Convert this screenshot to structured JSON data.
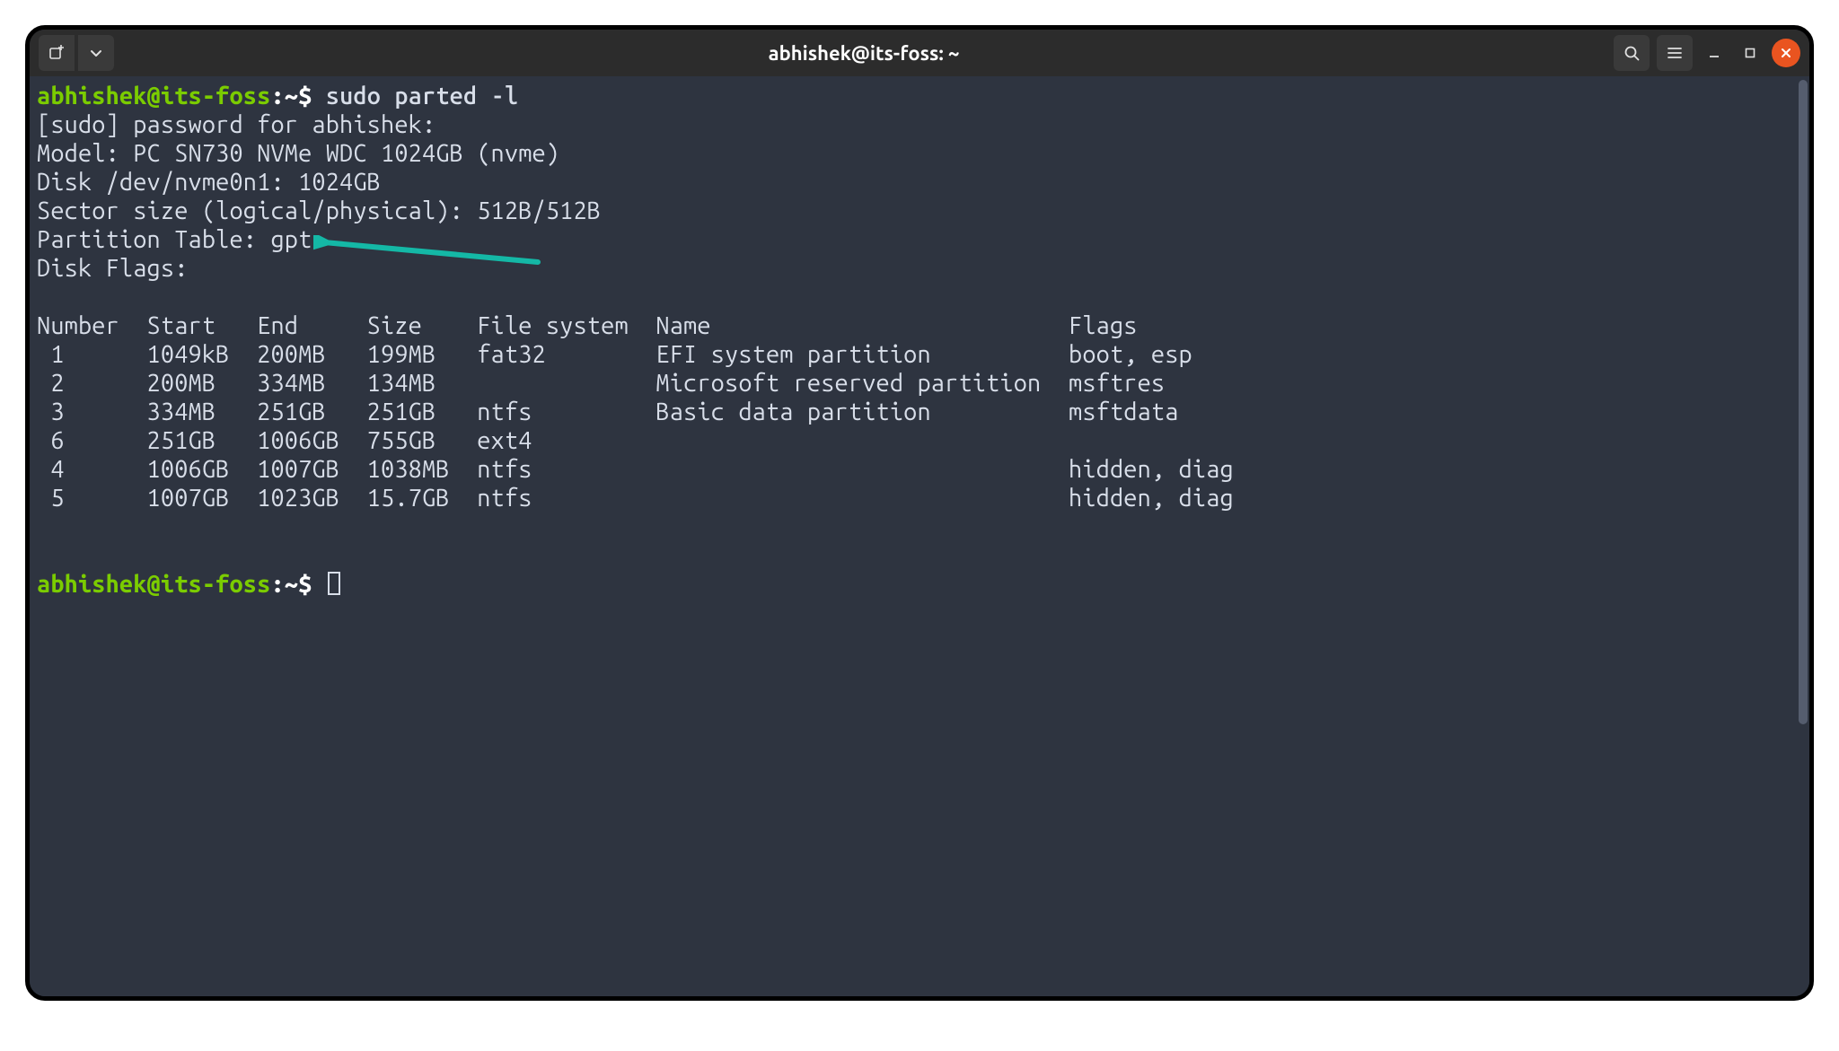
{
  "window": {
    "title": "abhishek@its-foss: ~"
  },
  "prompt": {
    "user_host": "abhishek@its-foss",
    "sep": ":",
    "path": "~",
    "symbol": "$"
  },
  "command": "sudo parted -l",
  "output": {
    "sudo_prompt": "[sudo] password for abhishek: ",
    "model": "Model: PC SN730 NVMe WDC 1024GB (nvme)",
    "disk": "Disk /dev/nvme0n1: 1024GB",
    "sector": "Sector size (logical/physical): 512B/512B",
    "part_table": "Partition Table: gpt",
    "disk_flags": "Disk Flags: "
  },
  "table": {
    "columns": [
      "Number",
      "Start",
      "End",
      "Size",
      "File system",
      "Name",
      "Flags"
    ],
    "rows": [
      {
        "number": "1",
        "start": "1049kB",
        "end": "200MB",
        "size": "199MB",
        "fs": "fat32",
        "name": "EFI system partition",
        "flags": "boot, esp"
      },
      {
        "number": "2",
        "start": "200MB",
        "end": "334MB",
        "size": "134MB",
        "fs": "",
        "name": "Microsoft reserved partition",
        "flags": "msftres"
      },
      {
        "number": "3",
        "start": "334MB",
        "end": "251GB",
        "size": "251GB",
        "fs": "ntfs",
        "name": "Basic data partition",
        "flags": "msftdata"
      },
      {
        "number": "6",
        "start": "251GB",
        "end": "1006GB",
        "size": "755GB",
        "fs": "ext4",
        "name": "",
        "flags": ""
      },
      {
        "number": "4",
        "start": "1006GB",
        "end": "1007GB",
        "size": "1038MB",
        "fs": "ntfs",
        "name": "",
        "flags": "hidden, diag"
      },
      {
        "number": "5",
        "start": "1007GB",
        "end": "1023GB",
        "size": "15.7GB",
        "fs": "ntfs",
        "name": "",
        "flags": "hidden, diag"
      }
    ]
  },
  "annotation": {
    "target": "Partition Table: gpt",
    "color": "#14b8a6"
  },
  "colors": {
    "terminal_bg": "#2e3440",
    "terminal_fg": "#d8dee9",
    "prompt_green": "#7bcc00",
    "close_button": "#e95420"
  }
}
